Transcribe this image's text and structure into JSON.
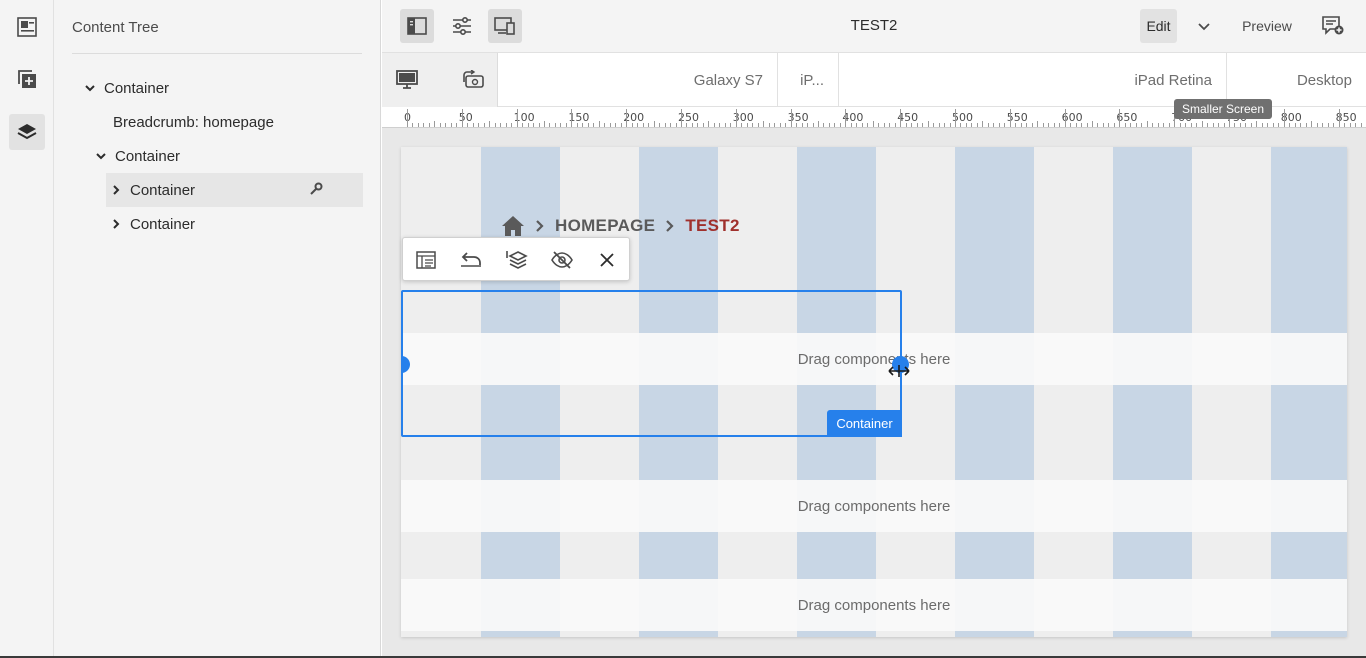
{
  "rail": {
    "items": [
      {
        "icon": "page-info-icon"
      },
      {
        "icon": "add-component-icon"
      },
      {
        "icon": "layers-icon",
        "active": true
      }
    ]
  },
  "content_tree": {
    "title": "Content Tree",
    "items": [
      {
        "label": "Container",
        "expanded": true
      },
      {
        "label": "Breadcrumb: homepage"
      },
      {
        "label": "Container",
        "expanded": true
      },
      {
        "label": "Container",
        "expanded": false,
        "selected": true
      },
      {
        "label": "Container",
        "expanded": false
      }
    ]
  },
  "toolbar": {
    "page_title": "TEST2",
    "edit_label": "Edit",
    "preview_label": "Preview"
  },
  "emulator": {
    "devices": [
      "Galaxy S7",
      "iP...",
      "iPad Retina",
      "Desktop"
    ],
    "tooltip": "Smaller Screen"
  },
  "ruler": {
    "labels": [
      "0",
      "50",
      "100",
      "150",
      "200",
      "250",
      "300",
      "350",
      "400",
      "450",
      "500",
      "550",
      "600",
      "650",
      "700",
      "750",
      "800",
      "850"
    ]
  },
  "page": {
    "breadcrumb": {
      "home": "HOMEPAGE",
      "current": "TEST2"
    },
    "dropzones": [
      "Drag components here",
      "Drag components here",
      "Drag components here"
    ],
    "selected_label": "Container"
  },
  "colors": {
    "accent": "#2680eb",
    "breadcrumb_current": "#a0302c",
    "layout_column": "#c8d6e5"
  }
}
